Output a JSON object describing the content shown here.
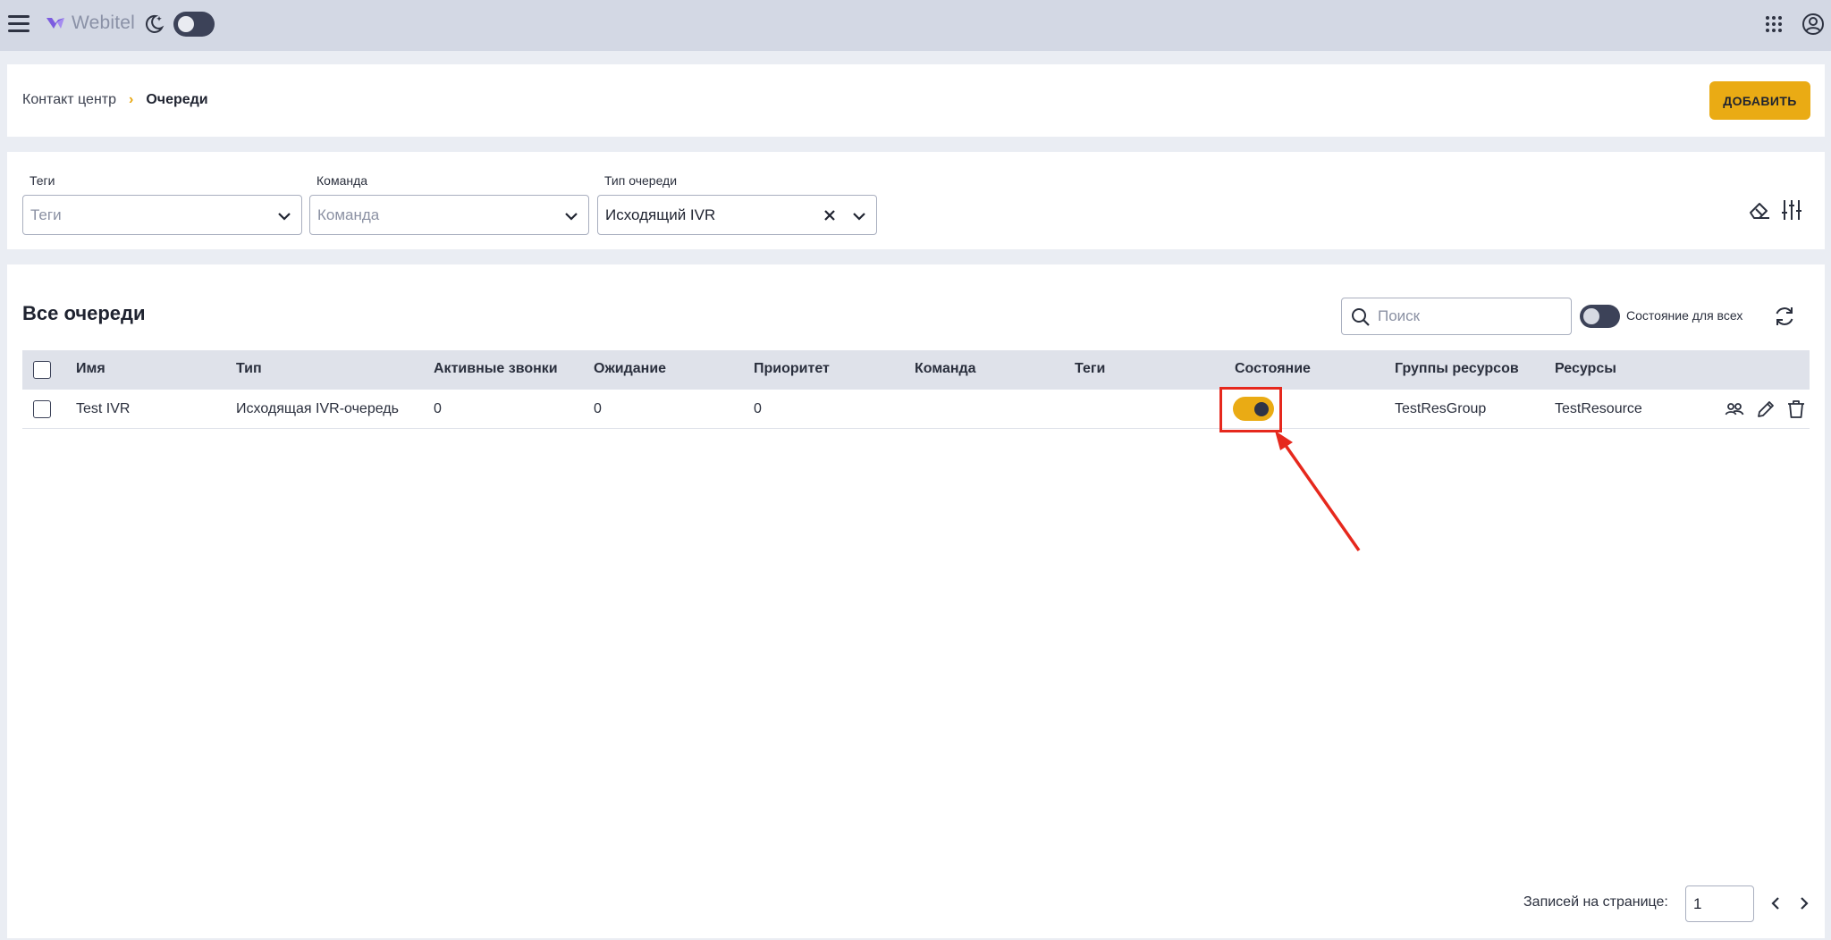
{
  "app": {
    "brand": "Webitel",
    "colors": {
      "accent": "#eaab14",
      "topbar": "#d3d8e4",
      "dark": "#3c4258",
      "annotation": "#e6281d"
    }
  },
  "breadcrumb": {
    "section": "Контакт центр",
    "separator": "›",
    "current": "Очереди"
  },
  "header": {
    "add_button": "ДОБАВИТЬ"
  },
  "filters": {
    "tags": {
      "label": "Теги",
      "placeholder": "Теги"
    },
    "team": {
      "label": "Команда",
      "placeholder": "Команда"
    },
    "queue_type": {
      "label": "Тип очереди",
      "value": "Исходящий IVR"
    }
  },
  "table": {
    "title": "Все очереди",
    "search_placeholder": "Поиск",
    "state_all_label": "Состояние для всех",
    "columns": [
      "Имя",
      "Тип",
      "Активные звонки",
      "Ожидание",
      "Приоритет",
      "Команда",
      "Теги",
      "Состояние",
      "Группы ресурсов",
      "Ресурсы"
    ],
    "rows": [
      {
        "name": "Test IVR",
        "type": "Исходящая IVR-очередь",
        "active_calls": "0",
        "waiting": "0",
        "priority": "0",
        "team": "",
        "tags": "",
        "state_on": true,
        "resource_groups": "TestResGroup",
        "resources": "TestResource"
      }
    ]
  },
  "pagination": {
    "label": "Записей на странице:",
    "value": "1"
  },
  "icons": [
    "menu-icon",
    "webitel-logo-icon",
    "moon-icon",
    "apps-grid-icon",
    "user-icon",
    "chevron-down-icon",
    "close-icon",
    "eraser-icon",
    "sliders-icon",
    "search-icon",
    "refresh-icon",
    "members-icon",
    "edit-icon",
    "trash-icon",
    "chevron-left-icon",
    "chevron-right-icon"
  ]
}
